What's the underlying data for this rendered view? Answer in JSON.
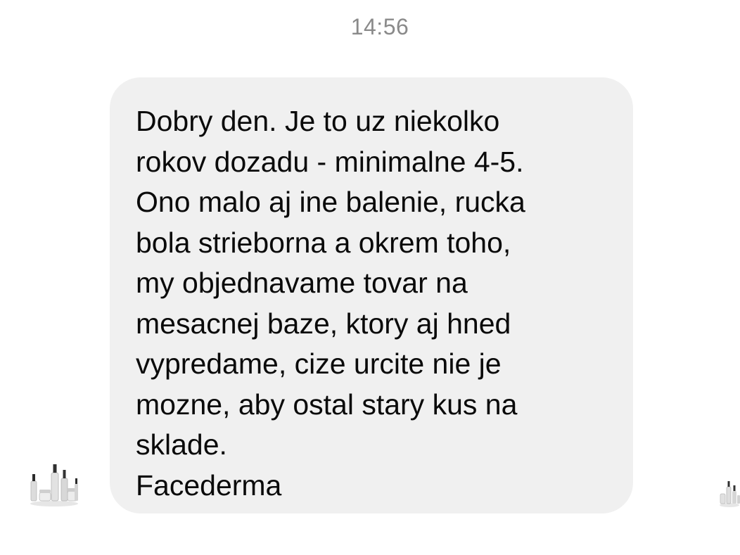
{
  "conversation": {
    "timestamp": "14:56",
    "message": {
      "lines": [
        "Dobry den. Je to uz niekolko",
        "rokov dozadu - minimalne 4-5.",
        "Ono malo aj ine balenie, rucka",
        "bola strieborna a okrem toho,",
        "my objednavame tovar na",
        "mesacnej baze, ktory aj hned",
        "vypredame, cize urcite nie je",
        "mozne, aby ostal stary kus na",
        "sklade.",
        "Facederma"
      ]
    },
    "sender_avatar": {
      "icon": "product-bottles-icon"
    }
  },
  "colors": {
    "background": "#ffffff",
    "bubble": "#f0f0f0",
    "text": "#0a0a0a",
    "timestamp": "#8a8a8a"
  }
}
